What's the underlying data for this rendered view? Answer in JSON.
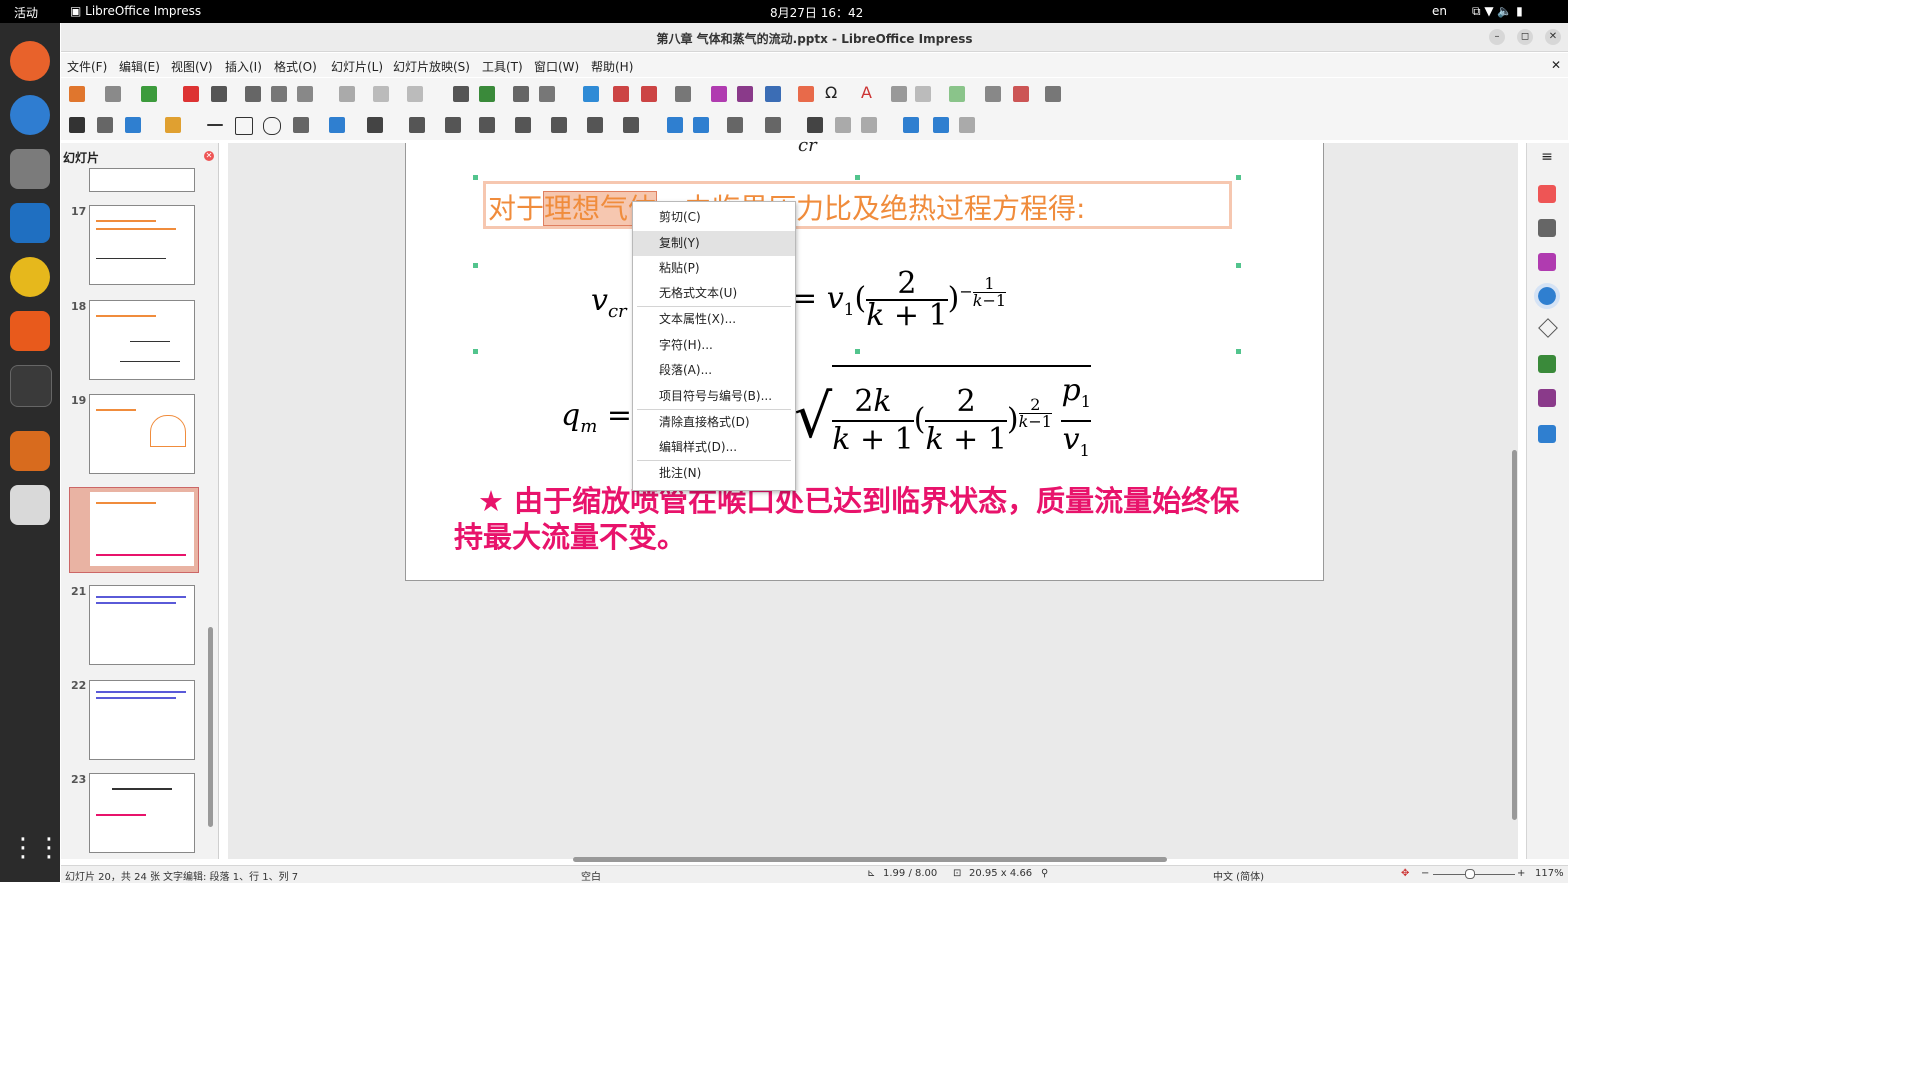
{
  "topbar": {
    "activities": "活动",
    "app": "LibreOffice Impress",
    "clock": "8月27日  16：42",
    "lang": "en"
  },
  "window": {
    "title": "第八章 气体和蒸气的流动.pptx - LibreOffice Impress"
  },
  "menubar": [
    "文件(F)",
    "编辑(E)",
    "视图(V)",
    "插入(I)",
    "格式(O)",
    "幻灯片(L)",
    "幻灯片放映(S)",
    "工具(T)",
    "窗口(W)",
    "帮助(H)"
  ],
  "slidepane": {
    "title": "幻灯片",
    "slides": [
      "17",
      "18",
      "19",
      "20",
      "21",
      "22",
      "23"
    ],
    "selected": "20"
  },
  "slide": {
    "heading_a": "对于",
    "heading_sel": "理想气体",
    "heading_b": "，由临界压力比及绝热过程方程得:",
    "eq1_lhs": "v",
    "eq1_lhs_sub": "cr",
    "eq2_lhs": "q",
    "eq2_lhs_sub": "m",
    "eq_top_fragment": "cr",
    "note": "★ 由于缩放喷管在喉口处已达到临界状态，质量流量始终保持最大流量不变。"
  },
  "context_menu": {
    "items": [
      "剪切(C)",
      "复制(Y)",
      "粘贴(P)",
      "无格式文本(U)",
      "文本属性(X)...",
      "字符(H)...",
      "段落(A)...",
      "项目符号与编号(B)...",
      "清除直接格式(D)",
      "编辑样式(D)...",
      "批注(N)"
    ],
    "hovered": "复制(Y)"
  },
  "status": {
    "slide": "幻灯片 20，共 24 张",
    "edit": "文字编辑: 段落 1、行 1、列 7",
    "layout": "空白",
    "pos": "1.99 / 8.00",
    "size": "20.95 x 4.66",
    "lang": "中文 (简体)",
    "zoom": "117%"
  },
  "colors": {
    "accent_orange": "#f08c3c",
    "note_red": "#e8136b",
    "handle": "#52c48d"
  }
}
